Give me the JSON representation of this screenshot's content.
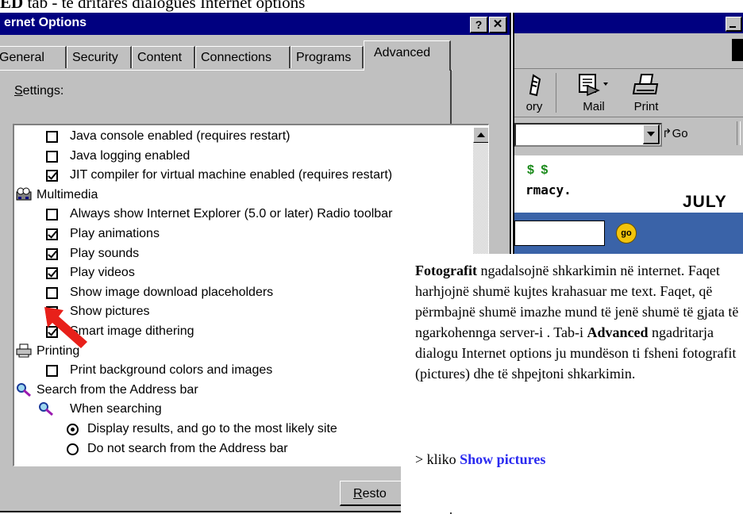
{
  "caption": {
    "bold": "ED",
    "text": " tab - te dritares dialogues  Internet options"
  },
  "dialog": {
    "title": "ernet Options",
    "help_label": "?",
    "close_label": "✕",
    "tabs": [
      {
        "label": "General"
      },
      {
        "label": "Security"
      },
      {
        "label": "Content"
      },
      {
        "label": "Connections"
      },
      {
        "label": "Programs"
      },
      {
        "label": "Advanced"
      }
    ],
    "selected_tab": "Advanced",
    "settings_label": "Settings:",
    "settings_accel": "S",
    "settings_rest": "ettings:",
    "items": [
      {
        "type": "checkbox",
        "checked": false,
        "label": "Java console enabled (requires restart)"
      },
      {
        "type": "checkbox",
        "checked": false,
        "label": "Java logging enabled"
      },
      {
        "type": "checkbox",
        "checked": true,
        "label": "JIT compiler for virtual machine enabled (requires restart)"
      },
      {
        "type": "group",
        "icon": "multimedia-icon",
        "label": "Multimedia"
      },
      {
        "type": "checkbox",
        "checked": false,
        "label": "Always show Internet Explorer (5.0 or later) Radio toolbar"
      },
      {
        "type": "checkbox",
        "checked": true,
        "label": "Play animations"
      },
      {
        "type": "checkbox",
        "checked": true,
        "label": "Play sounds"
      },
      {
        "type": "checkbox",
        "checked": true,
        "label": "Play videos"
      },
      {
        "type": "checkbox",
        "checked": false,
        "label": "Show image download placeholders"
      },
      {
        "type": "checkbox",
        "checked": true,
        "label": "Show pictures"
      },
      {
        "type": "checkbox",
        "checked": true,
        "label": "Smart image dithering"
      },
      {
        "type": "group",
        "icon": "printer-icon",
        "label": "Printing"
      },
      {
        "type": "checkbox",
        "checked": false,
        "label": "Print background colors and images"
      },
      {
        "type": "group",
        "icon": "magnifier-icon",
        "label": "Search from the Address bar"
      },
      {
        "type": "subgroup",
        "icon": "magnifier-icon",
        "label": "When searching"
      },
      {
        "type": "radio",
        "checked": true,
        "label": "Display results, and go to the most likely site"
      },
      {
        "type": "radio",
        "checked": false,
        "label": "Do not search from the Address bar"
      }
    ],
    "restore_button": "Resto",
    "restore_accel": "R",
    "restore_rest": "esto"
  },
  "browser": {
    "toolbar": [
      {
        "label": "ory",
        "icon": "history-icon"
      },
      {
        "label": "Mail",
        "icon": "mail-icon"
      },
      {
        "label": "Print",
        "icon": "print-icon"
      }
    ],
    "go_label": "Go",
    "page": {
      "dollars": "$ $",
      "fragment": "rmacy.",
      "month": "JULY",
      "go_button": "go"
    }
  },
  "callout": {
    "bold_lead": "Fotografit",
    "p1": " ngadalsojnë shkarkimin në internet. Faqet harhjojnë shumë kujtes krahasuar me text. Faqet, që përmbajnë shumë imazhe mund të jenë shumë të gjata të ngarkohenngа server-i . Tab-i ",
    "bold_mid": "Advanced",
    "p2": " ngadritarja dialogu  Internet options ju mundëson ti fsheni fotografit (pictures) dhe të shpejtoni shkarkimin.",
    "action_prefix": "> kliko ",
    "action_bold": "Show pictures"
  },
  "colors": {
    "titlebar": "#000080",
    "face": "#c0c0c0",
    "arrow": "#e8201a",
    "link": "#2a2af0",
    "page_band": "#3a63a8"
  }
}
